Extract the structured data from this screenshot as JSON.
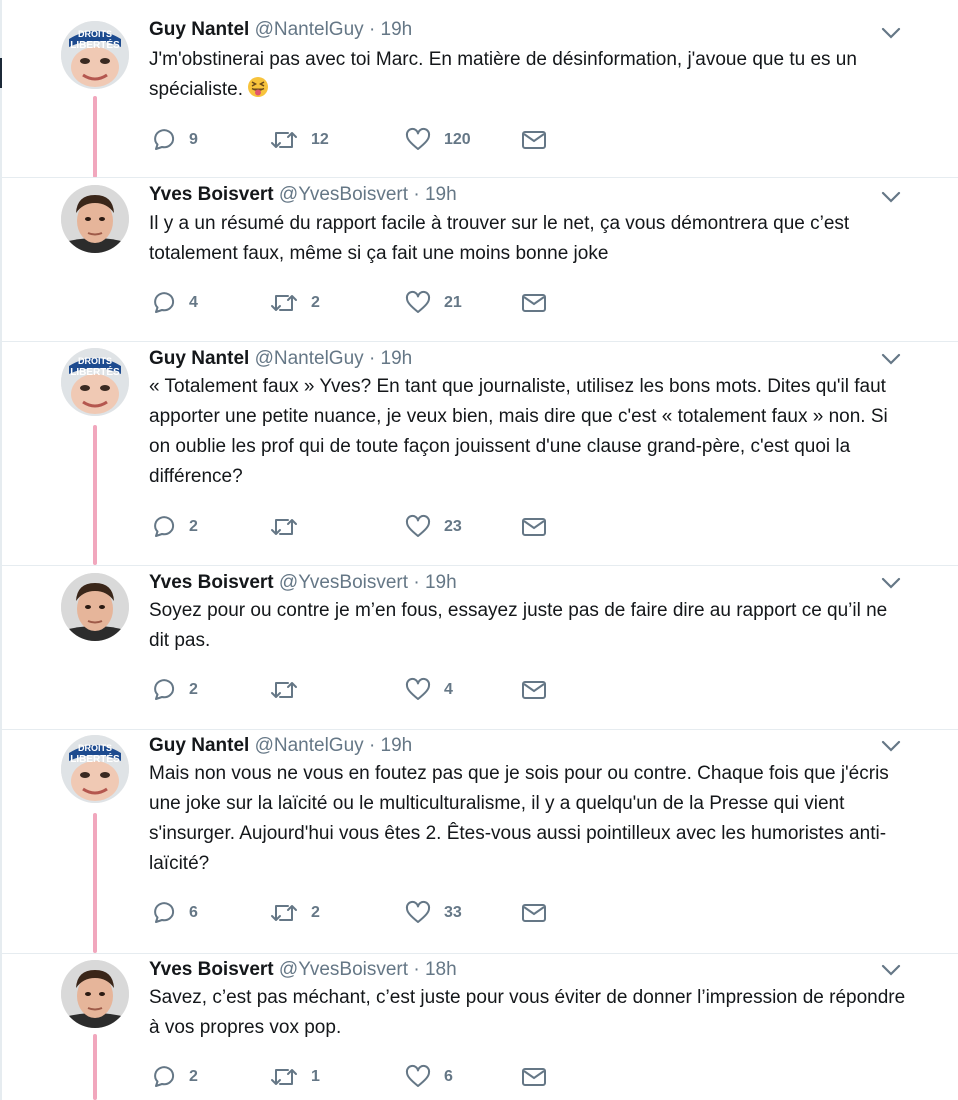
{
  "tweets": [
    {
      "author": "guy",
      "name": "Guy Nantel",
      "handle": "@NantelGuy",
      "separator": "·",
      "time": "19h",
      "text": "J'm'obstinerai pas avec toi Marc. En matière de désinformation, j'avoue que tu es un spécialiste.",
      "emoji": "squinting-face-with-tongue",
      "replies": "9",
      "retweets": "12",
      "likes": "120"
    },
    {
      "author": "yves",
      "name": "Yves Boisvert",
      "handle": "@YvesBoisvert",
      "separator": "·",
      "time": "19h",
      "text": "Il y a un résumé du rapport facile à trouver sur le net, ça vous démontrera que c’est totalement faux, même si ça fait une moins bonne joke",
      "replies": "4",
      "retweets": "2",
      "likes": "21"
    },
    {
      "author": "guy",
      "name": "Guy Nantel",
      "handle": "@NantelGuy",
      "separator": "·",
      "time": "19h",
      "text": "« Totalement faux » Yves? En tant que journaliste, utilisez les bons mots. Dites qu'il faut apporter une petite nuance, je veux bien, mais dire que c'est « totalement faux » non. Si on oublie les prof qui de toute façon jouissent d'une clause grand-père, c'est quoi la différence?",
      "replies": "2",
      "retweets": "",
      "likes": "23"
    },
    {
      "author": "yves",
      "name": "Yves Boisvert",
      "handle": "@YvesBoisvert",
      "separator": "·",
      "time": "19h",
      "text": "Soyez pour ou contre je m’en fous, essayez juste pas de faire dire au rapport ce qu’il ne dit pas.",
      "replies": "2",
      "retweets": "",
      "likes": "4"
    },
    {
      "author": "guy",
      "name": "Guy Nantel",
      "handle": "@NantelGuy",
      "separator": "·",
      "time": "19h",
      "text": "Mais non vous ne vous en foutez pas que je sois pour ou contre. Chaque fois que j'écris une joke sur la laïcité ou le multiculturalisme, il y a quelqu'un de la Presse qui vient s'insurger. Aujourd'hui vous êtes 2. Êtes-vous aussi pointilleux avec les humoristes anti-laïcité?",
      "replies": "6",
      "retweets": "2",
      "likes": "33"
    },
    {
      "author": "yves",
      "name": "Yves Boisvert",
      "handle": "@YvesBoisvert",
      "separator": "·",
      "time": "18h",
      "text": "Savez, c’est pas méchant, c’est juste pour vous éviter de donner l’impression de répondre à vos propres vox pop.",
      "replies": "2",
      "retweets": "1",
      "likes": "6"
    }
  ],
  "avatar_text": {
    "guy": "DROITS ET LIBERTÉS"
  },
  "colors": {
    "thread_line": "#f1a7bd",
    "secondary_text": "#657786",
    "primary_text": "#14171a"
  }
}
